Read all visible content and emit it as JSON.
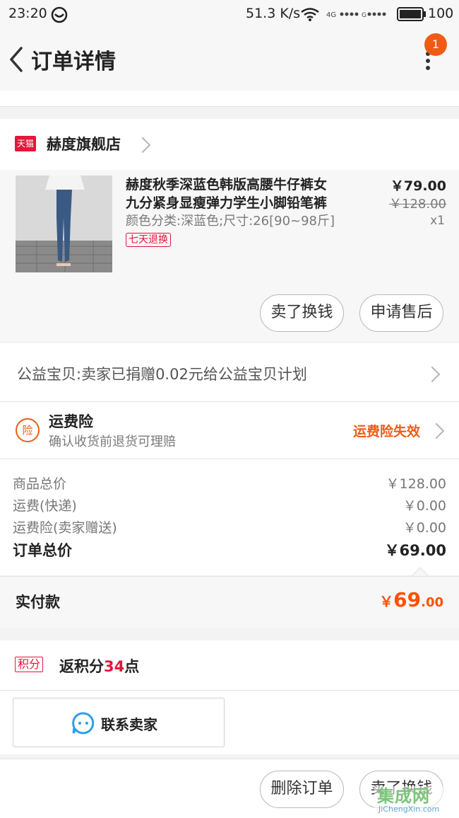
{
  "status_bar": {
    "time": "23:20",
    "speed": "51.3 K/s",
    "battery": "100"
  },
  "nav": {
    "title": "订单详情",
    "badge": "1"
  },
  "shop": {
    "logo": "天猫",
    "name": "赫度旗舰店"
  },
  "product": {
    "title_line1": "赫度秋季深蓝色韩版高腰牛仔裤女",
    "title_line2": "九分紧身显瘦弹力学生小脚铅笔裤",
    "sku": "颜色分类:深蓝色;尺寸:26[90~98斤]",
    "tag": "七天退换",
    "price": "￥79.00",
    "original_price": "￥128.00",
    "qty": "x1"
  },
  "product_actions": {
    "sell": "卖了换钱",
    "after_sale": "申请售后"
  },
  "charity": {
    "text": "公益宝贝:卖家已捐赠0.02元给公益宝贝计划"
  },
  "insurance": {
    "icon": "险",
    "title": "运费险",
    "subtitle": "确认收货前退货可理赔",
    "status": "运费险失效"
  },
  "fees": [
    {
      "label": "商品总价",
      "value": "￥128.00"
    },
    {
      "label": "运费(快递)",
      "value": "￥0.00"
    },
    {
      "label": "运费险(卖家赠送)",
      "value": "￥0.00"
    }
  ],
  "order_total": {
    "label": "订单总价",
    "value": "￥69.00"
  },
  "paid": {
    "label": "实付款",
    "currency": "￥",
    "int": "69",
    "dec": ".00"
  },
  "points": {
    "tag": "积分",
    "prefix": "返积分",
    "num": "34",
    "suffix": "点"
  },
  "contact": {
    "label": "联系卖家"
  },
  "bottom_actions": {
    "delete": "删除订单",
    "sell": "卖了换钱"
  },
  "watermark": {
    "brand": "集成网",
    "url": "JiChengXin.com"
  },
  "colors": {
    "accent": "#f05b14",
    "tmall_red": "#e4163c",
    "price_orange": "#ff5000"
  }
}
